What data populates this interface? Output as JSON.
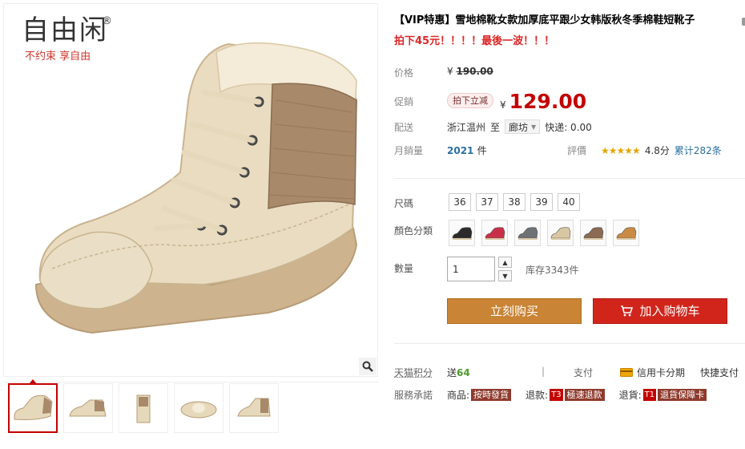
{
  "brand": {
    "name": "自由闲",
    "reg": "®",
    "slogan": "不约束 享自由"
  },
  "product": {
    "title": "【VIP特惠】雪地棉靴女款加厚底平跟少女韩版秋冬季棉鞋短靴子",
    "promo": "拍下45元！！！！最後一波！！！"
  },
  "price": {
    "label": "价格",
    "currency": "¥",
    "original": "190.00",
    "promo_label": "促銷",
    "promo_tag": "拍下立减",
    "current": "129.00"
  },
  "shipping": {
    "label": "配送",
    "from": "浙江温州",
    "to_word": "至",
    "destination": "廊坊",
    "fee": "快递: 0.00"
  },
  "sales": {
    "label": "月銷量",
    "count": "2021",
    "unit": "件"
  },
  "review": {
    "label": "評價",
    "stars": "★★★★★",
    "score": "4.8分",
    "count": "累计282条"
  },
  "sizes": {
    "label": "尺碼",
    "options": [
      "36",
      "37",
      "38",
      "39",
      "40"
    ]
  },
  "colors": {
    "label": "顏色分類",
    "options": [
      {
        "name": "black",
        "color": "#2b2b2b"
      },
      {
        "name": "rose",
        "color": "#c8304a"
      },
      {
        "name": "grey",
        "color": "#6f7275"
      },
      {
        "name": "beige",
        "color": "#d9c7a4"
      },
      {
        "name": "brown",
        "color": "#8a6a52"
      },
      {
        "name": "camel",
        "color": "#c98a45"
      }
    ]
  },
  "quantity": {
    "label": "數量",
    "value": "1",
    "stock": "库存3343件"
  },
  "buttons": {
    "buy_now": "立刻购买",
    "add_cart": "加入购物车"
  },
  "points": {
    "label": "天猫积分",
    "prefix": "送",
    "value": "64"
  },
  "payment": {
    "label": "支付",
    "credit": "信用卡分期",
    "fast": "快捷支付"
  },
  "service": {
    "label": "服務承諾",
    "items": [
      {
        "prefix": "商品:",
        "code": "",
        "tag": "按時發貨"
      },
      {
        "prefix": "退款:",
        "code": "T3",
        "tag": "極速退款"
      },
      {
        "prefix": "退貨:",
        "code": "T1",
        "tag": "退貨保障卡"
      }
    ]
  },
  "colors_theme": {
    "price_red": "#c40000",
    "buy": "#c98436",
    "cart": "#d1251b"
  }
}
